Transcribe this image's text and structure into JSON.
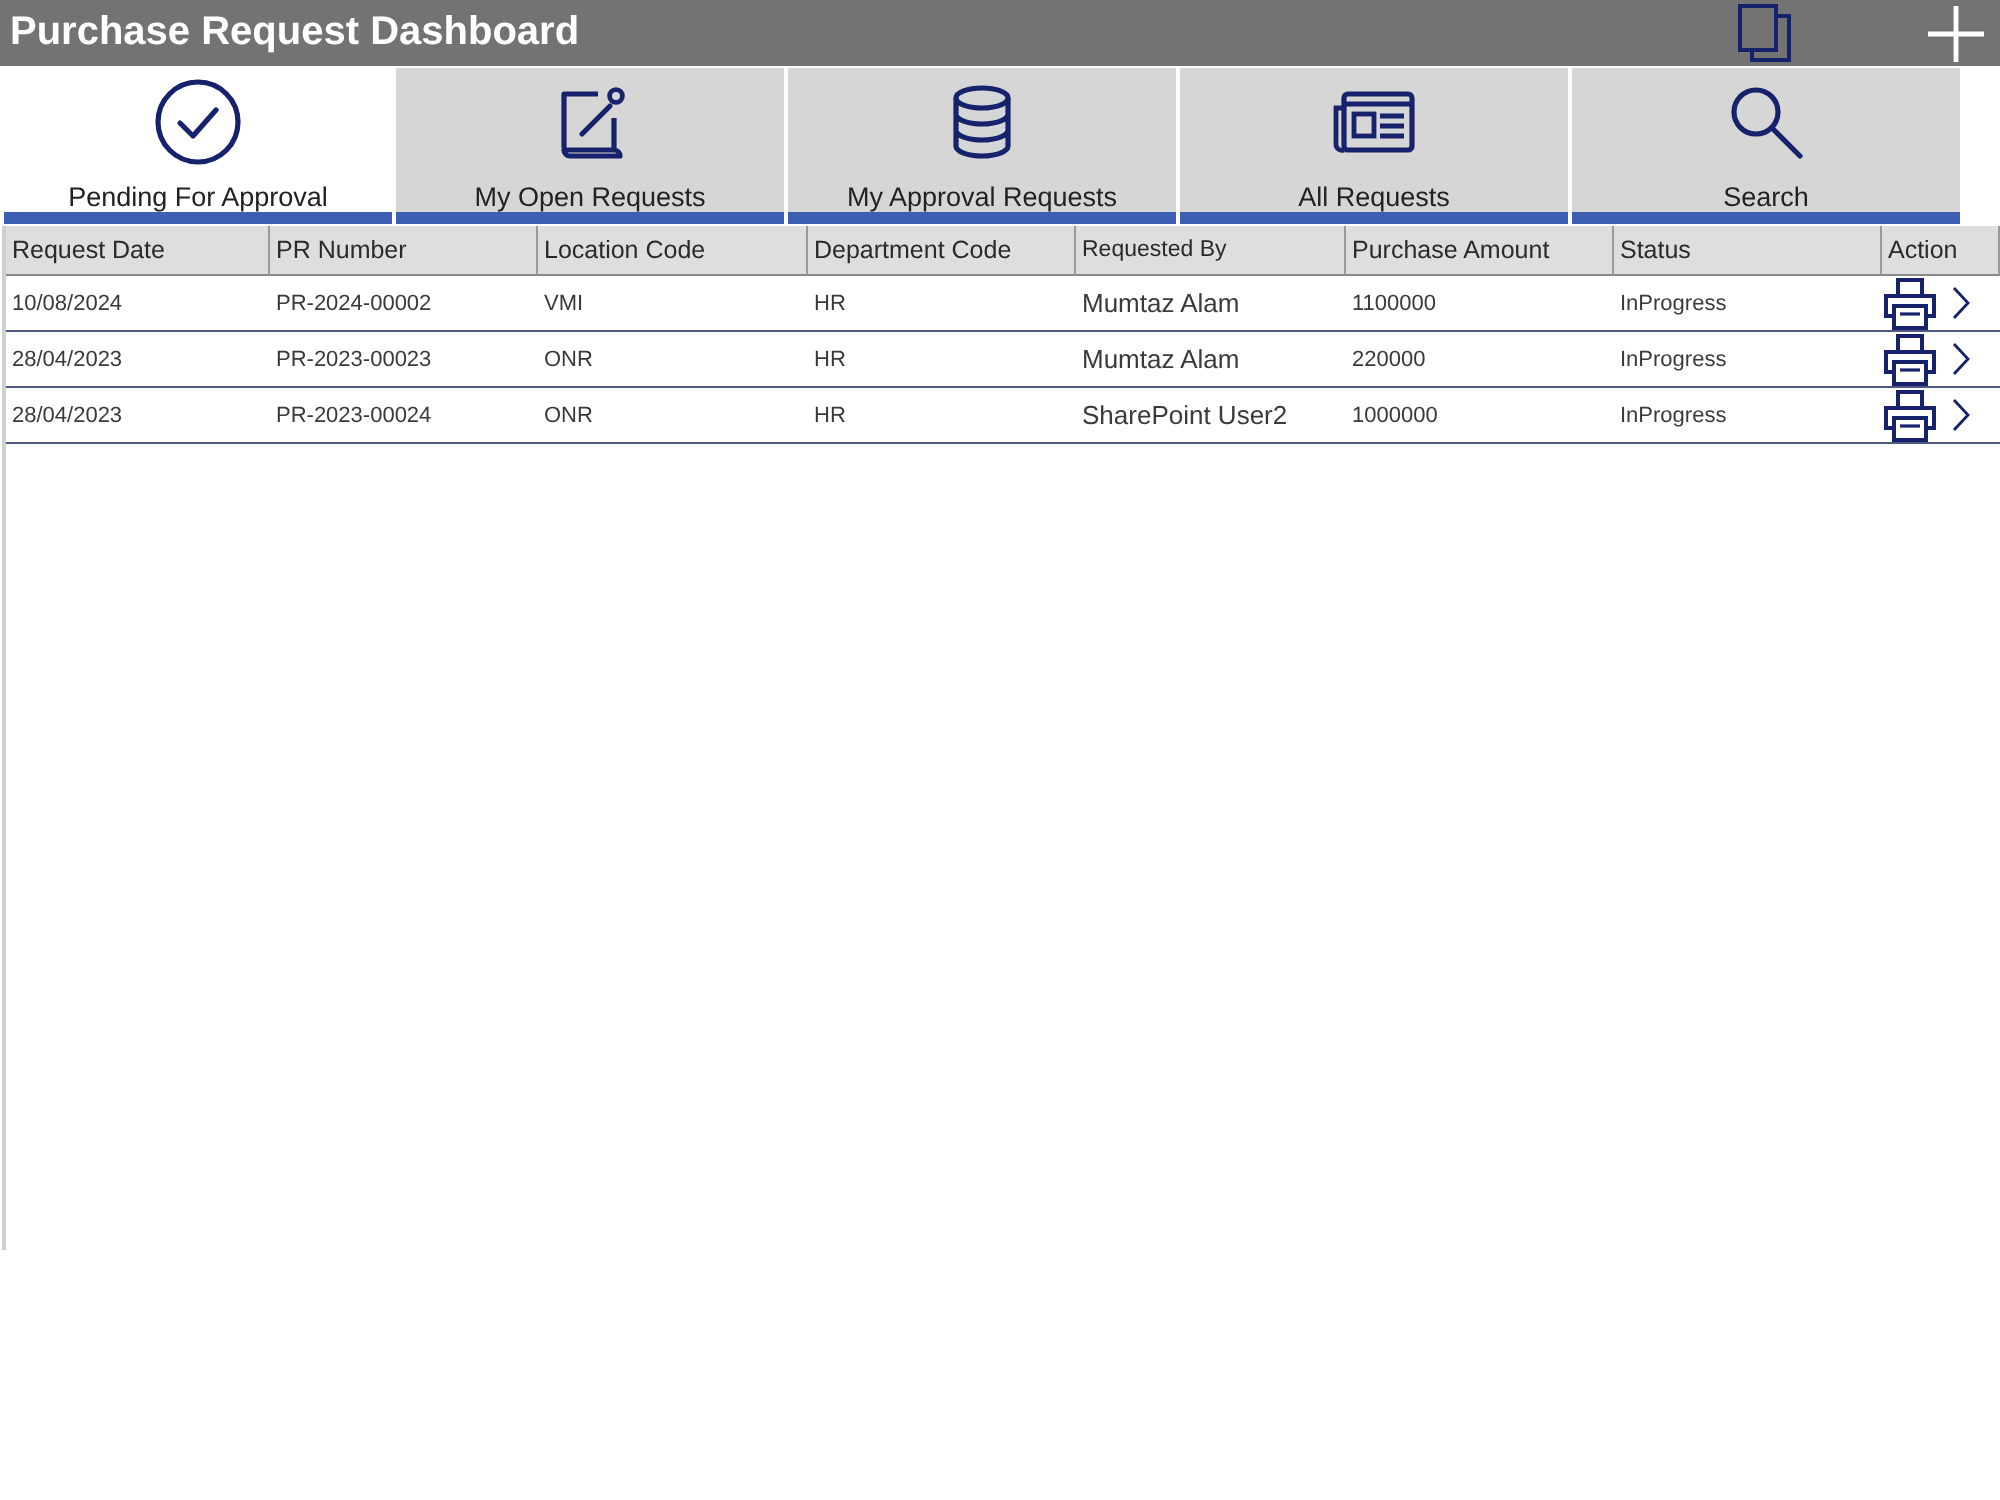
{
  "header": {
    "title": "Purchase Request Dashboard"
  },
  "tabs": [
    {
      "label": "Pending For Approval",
      "selected": true
    },
    {
      "label": "My Open Requests",
      "selected": false
    },
    {
      "label": "My Approval Requests",
      "selected": false
    },
    {
      "label": "All Requests",
      "selected": false
    },
    {
      "label": "Search",
      "selected": false
    }
  ],
  "table": {
    "columns": [
      "Request Date",
      "PR Number",
      "Location Code",
      "Department Code",
      "Requested By",
      "Purchase Amount",
      "Status",
      "Action"
    ],
    "rows": [
      {
        "cells": [
          "10/08/2024",
          "PR-2024-00002",
          "VMI",
          "HR",
          "Mumtaz Alam",
          "1100000",
          "InProgress"
        ]
      },
      {
        "cells": [
          "28/04/2023",
          "PR-2023-00023",
          "ONR",
          "HR",
          "Mumtaz Alam",
          "220000",
          "InProgress"
        ]
      },
      {
        "cells": [
          "28/04/2023",
          "PR-2023-00024",
          "ONR",
          "HR",
          "SharePoint User2",
          "1000000",
          "InProgress"
        ]
      }
    ]
  }
}
